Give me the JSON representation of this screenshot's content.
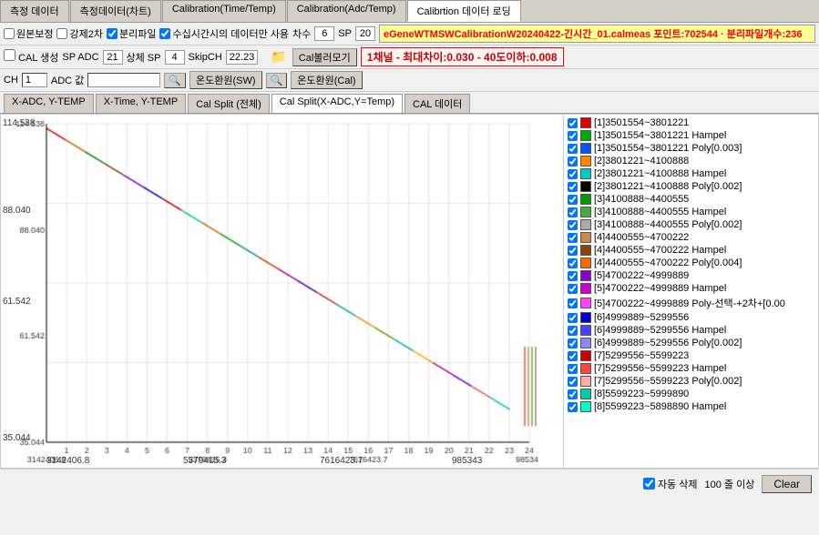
{
  "tabs": {
    "items": [
      "측정 데이터",
      "측정데이터(차트)",
      "Calibration(Time/Temp)",
      "Calibration(Adc/Temp)",
      "Calibrtion 데이터 로딩"
    ],
    "active": 4
  },
  "toolbar1": {
    "cb_original": "원본보정",
    "cb_force2": "강제2차",
    "cb_split": "분리파일",
    "cb_time": "수십시간시의 데이터만 사용",
    "label_count": "차수",
    "val_count": "6",
    "label_sp": "SP",
    "val_sp": "20",
    "status_text": "eGeneWTMSWCalibrationW20240422-긴시간_01.calmeas 포인트:702544 · 분리파일개수:236"
  },
  "toolbar2": {
    "cb_cal": "CAL 생성",
    "label_spadc": "SP ADC",
    "val_spadc": "21",
    "label_sp2": "상체 SP",
    "val_sp2": "4",
    "label_skipch": "SkipCH",
    "val_skipch": "22.23",
    "btn_calfile": "Cal볼러모기",
    "big_status": "1채널 - 최대차이:0.030 - 40도이하:0.008"
  },
  "toolbar3": {
    "label_ch": "CH",
    "val_ch": "1",
    "label_adc": "ADC 값",
    "btn_temp_sw": "온도환원(SW)",
    "btn_temp_cal": "온도환원(Cal)"
  },
  "subtabs": {
    "items": [
      "X-ADC, Y-TEMP",
      "X-Time, Y-TEMP",
      "Cal Split (전체)",
      "Cal Split(X-ADC,Y=Temp)",
      "CAL 데이터"
    ],
    "active": 3
  },
  "chart": {
    "y_max": "114.538",
    "y_mid": "88.040",
    "y_mid2": "61.542",
    "y_min": "35.044",
    "x_min": "3142406.8",
    "x_mid1": "5379415.3",
    "x_mid2": "7616423.7",
    "x_max": "985343",
    "x_labels": [
      "1",
      "2",
      "3",
      "4",
      "5",
      "6",
      "7",
      "8",
      "9",
      "10",
      "11",
      "12",
      "13",
      "14",
      "15",
      "16",
      "17",
      "18",
      "19",
      "20",
      "21",
      "22",
      "23",
      "24"
    ]
  },
  "legend": {
    "items": [
      {
        "color": "#e00000",
        "checked": true,
        "label": "[1]3501554~3801221"
      },
      {
        "color": "#00aa00",
        "checked": true,
        "label": "[1]3501554~3801221 Hampel"
      },
      {
        "color": "#0055ff",
        "checked": true,
        "label": "[1]3501554~3801221 Poly[0.003]"
      },
      {
        "color": "#ff8800",
        "checked": true,
        "label": "[2]3801221~4100888"
      },
      {
        "color": "#00cccc",
        "checked": true,
        "label": "[2]3801221~4100888 Hampel"
      },
      {
        "color": "#000000",
        "checked": true,
        "label": "[2]3801221~4100888 Poly[0.002]"
      },
      {
        "color": "#009900",
        "checked": true,
        "label": "[3]4100888~4400555"
      },
      {
        "color": "#44aa44",
        "checked": true,
        "label": "[3]4100888~4400555 Hampel"
      },
      {
        "color": "#aaaaaa",
        "checked": true,
        "label": "[3]4100888~4400555 Poly[0.002]"
      },
      {
        "color": "#cc8844",
        "checked": true,
        "label": "[4]4400555~4700222"
      },
      {
        "color": "#884400",
        "checked": true,
        "label": "[4]4400555~4700222 Hampel"
      },
      {
        "color": "#ff6600",
        "checked": true,
        "label": "[4]4400555~4700222 Poly[0.004]"
      },
      {
        "color": "#8800cc",
        "checked": true,
        "label": "[5]4700222~4999889"
      },
      {
        "color": "#cc00cc",
        "checked": true,
        "label": "[5]4700222~4999889 Hampel"
      },
      {
        "color": "#ff44ff",
        "checked": true,
        "label": "[5]4700222~4999889 Poly-선택-+2차+[0.00"
      },
      {
        "color": "#0000cc",
        "checked": true,
        "label": "[6]4999889~5299556"
      },
      {
        "color": "#4444ff",
        "checked": true,
        "label": "[6]4999889~5299556 Hampel"
      },
      {
        "color": "#8888ff",
        "checked": true,
        "label": "[6]4999889~5299556 Poly[0.002]"
      },
      {
        "color": "#cc0000",
        "checked": true,
        "label": "[7]5299556~5599223"
      },
      {
        "color": "#ff4444",
        "checked": true,
        "label": "[7]5299556~5599223 Hampel"
      },
      {
        "color": "#ffaaaa",
        "checked": true,
        "label": "[7]5299556~5599223 Poly[0.002]"
      },
      {
        "color": "#00ccaa",
        "checked": true,
        "label": "[8]5599223~5999890"
      },
      {
        "color": "#00ffcc",
        "checked": true,
        "label": "[8]5599223~5898890 Hampel"
      }
    ]
  },
  "bottom": {
    "cb_auto_delete": "자동 삭제",
    "val_threshold": "100 줄 이상",
    "btn_clear": "Clear"
  }
}
